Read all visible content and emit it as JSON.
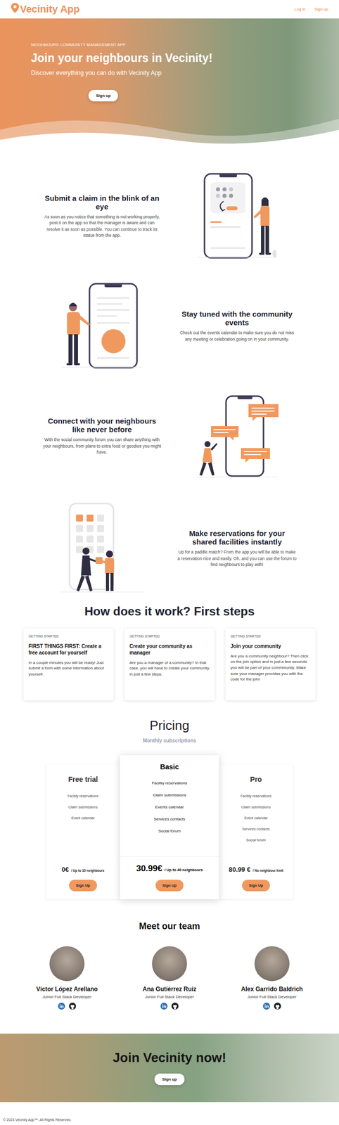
{
  "nav": {
    "logo": "Vecinity App",
    "links": [
      "Log in",
      "Sign up"
    ]
  },
  "hero": {
    "eyebrow": "NEIGHBOURS COMMUNITY MANAGEMENT APP",
    "title": "Join your neighbours in Vecinity!",
    "subtitle": "Discover everything you can do with Vecinity App",
    "button": "Sign up"
  },
  "features": [
    {
      "kind": "claim",
      "title": "Submit a claim in the blink of an eye",
      "text": "As soon as you notice that something is not working properly, post it on the app so that the manager is aware and can resolve it as soon as possible. You can continue to track its status from the app."
    },
    {
      "kind": "events",
      "title": "Stay tuned with the community events",
      "text": "Check out the events calendar to make sure you do not miss any meeting or celebration going on in your community."
    },
    {
      "kind": "forum",
      "title": "Connect with your neighbours like never before",
      "text": "With the social community forum you can share anything with your neighbours, from plans to extra food or goodies you might have."
    },
    {
      "kind": "reservations",
      "title": "Make reservations for your shared facilities instantly",
      "text": "Up for a paddle match? From the app you will be able to make a reservation nice and easily. Oh, and you can use the forum to find neighbours to play with!"
    }
  ],
  "steps": {
    "title": "How does it work? First steps",
    "cards": [
      {
        "eyebrow": "GETTING STARTED",
        "title": "FIRST THINGS FIRST: Create a free account for yourself",
        "text": "In a couple minutes you will be ready! Just submit a form with some information about yourself."
      },
      {
        "eyebrow": "GETTING STARTED",
        "title": "Create your community as manager",
        "text": "Are you a manager of a community? In that case, you will have to create your community in just a few steps."
      },
      {
        "eyebrow": "GETTING STARTED",
        "title": "Join your community",
        "text": "Are you a community neighbour? Then click on the join option and in just a few seconds you will be part of your commmunity. Make sure your manager provides you with the code for the join!"
      }
    ]
  },
  "pricing": {
    "title": "Pricing",
    "subtitle": "Monthly subscriptions",
    "plans": [
      {
        "name": "Free trial",
        "highlighted": false,
        "features": [
          "Facility reservations",
          "Claim submissions",
          "Event calendar"
        ],
        "price": "0€",
        "limit": "/ Up to 10 neighbours",
        "button": "Sign Up"
      },
      {
        "name": "Basic",
        "highlighted": true,
        "features": [
          "Facility reservations",
          "Claim submissions",
          "Events calendar",
          "Services contacts",
          "Social forum"
        ],
        "price": "30.99€",
        "limit": "/ Up to 40 neighbours",
        "button": "Sign Up"
      },
      {
        "name": "Pro",
        "highlighted": false,
        "features": [
          "Facility reservations",
          "Claim submissions",
          "Event calendar",
          "Services contacts",
          "Social forum"
        ],
        "price": "80.99 €",
        "limit": "/ No neighbour limit",
        "button": "Sign Up"
      }
    ]
  },
  "team": {
    "title": "Meet our team",
    "members": [
      {
        "name": "Víctor López Arellano",
        "role": "Junior Full Stack Developer"
      },
      {
        "name": "Ana Gutiérrez Ruiz",
        "role": "Junior Full Stack Developer"
      },
      {
        "name": "Alex Garrido Baldrich",
        "role": "Junior Full Stack Developer"
      }
    ]
  },
  "cta": {
    "title": "Join Vecinity now!",
    "button": "Sign up"
  },
  "footer": "© 2023 Vecinity App™. All Rights Reserved."
}
